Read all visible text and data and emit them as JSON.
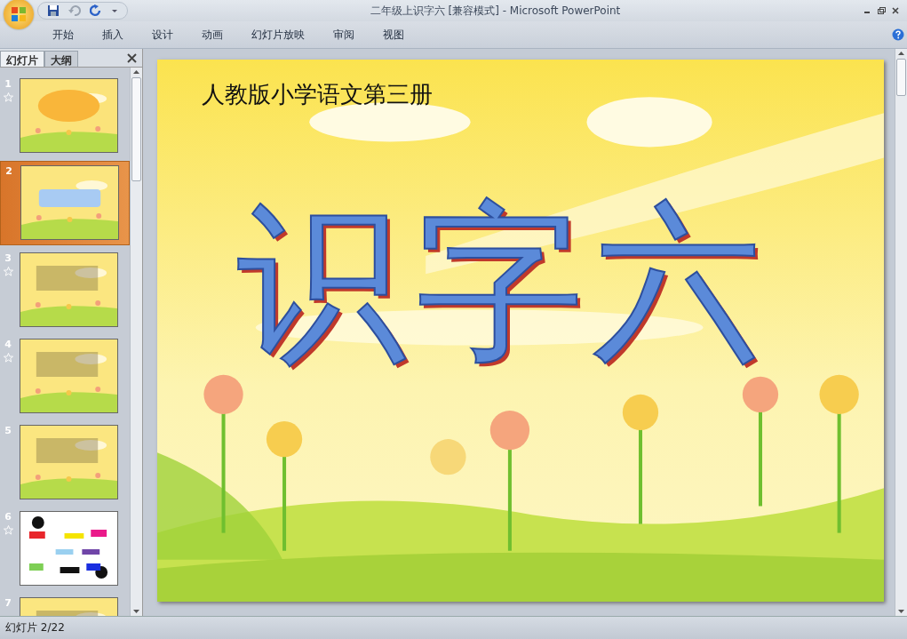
{
  "window": {
    "title": "二年级上识字六 [兼容模式] - Microsoft PowerPoint"
  },
  "ribbon_tabs": [
    {
      "label": "开始",
      "selected": false
    },
    {
      "label": "插入",
      "selected": false
    },
    {
      "label": "设计",
      "selected": false
    },
    {
      "label": "动画",
      "selected": false
    },
    {
      "label": "幻灯片放映",
      "selected": false
    },
    {
      "label": "审阅",
      "selected": false
    },
    {
      "label": "视图",
      "selected": false
    }
  ],
  "panel_tabs": [
    {
      "label": "幻灯片",
      "selected": true
    },
    {
      "label": "大纲",
      "selected": false
    }
  ],
  "slides": [
    {
      "number": "1",
      "animated": true,
      "selected": false
    },
    {
      "number": "2",
      "animated": false,
      "selected": true
    },
    {
      "number": "3",
      "animated": true,
      "selected": false
    },
    {
      "number": "4",
      "animated": true,
      "selected": false
    },
    {
      "number": "5",
      "animated": false,
      "selected": false
    },
    {
      "number": "6",
      "animated": true,
      "selected": false
    },
    {
      "number": "7",
      "animated": false,
      "selected": false
    }
  ],
  "slide": {
    "subtitle": "人教版小学语文第三册",
    "heading": "识字六"
  },
  "status_bar": {
    "slide_counter": "幻灯片 2/22"
  }
}
